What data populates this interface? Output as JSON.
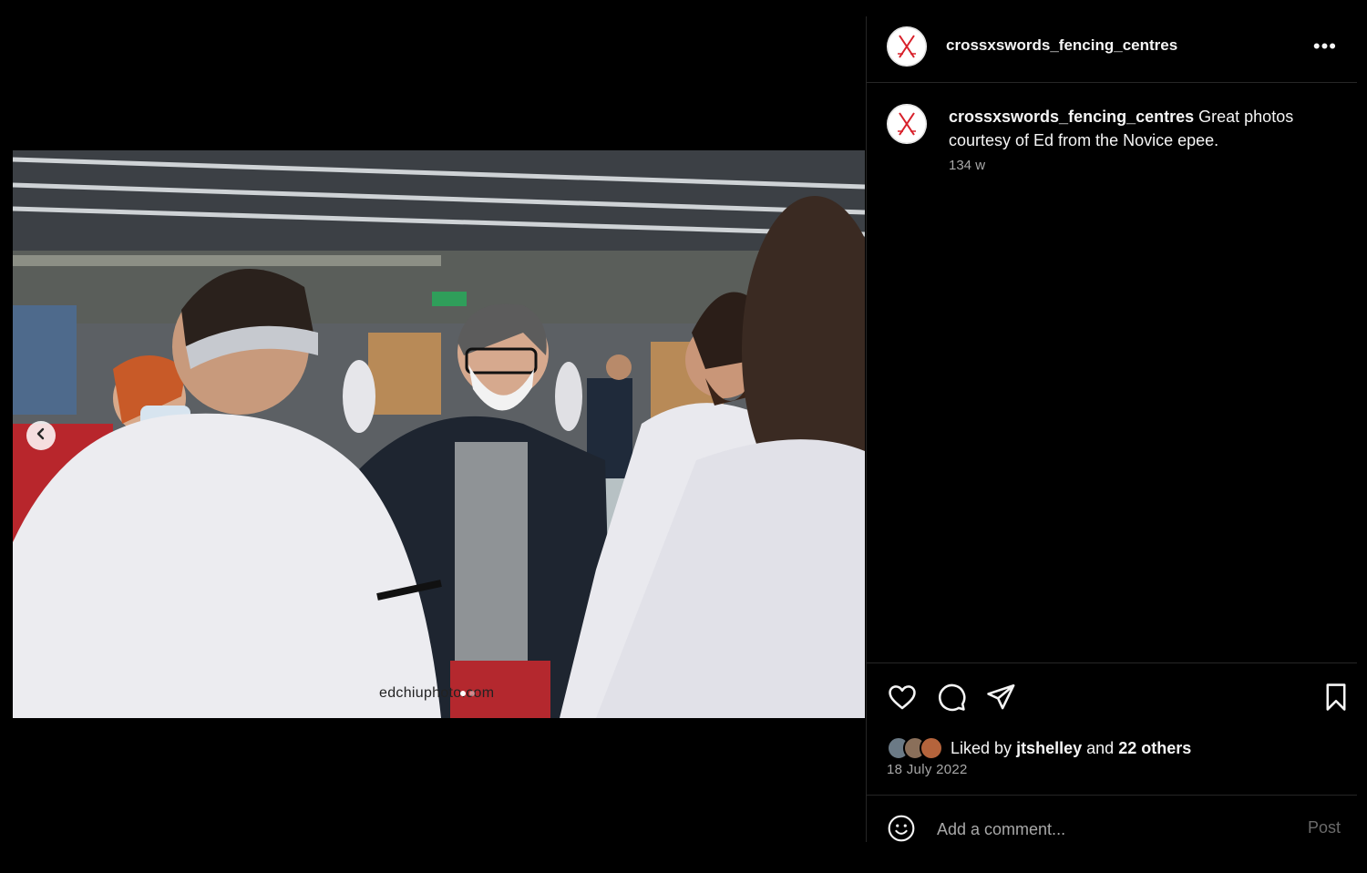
{
  "post": {
    "username": "crossxswords_fencing_centres",
    "more_label": "•••",
    "caption": {
      "username": "crossxswords_fencing_centres",
      "text": "Great photos courtesy of Ed from the Novice epee.",
      "time": "134 w"
    },
    "media": {
      "watermark": "edchiuphoto.com",
      "carousel_dots": 2,
      "active_dot": 0
    },
    "likes": {
      "prefix": "Liked by",
      "user": "jtshelley",
      "and": "and",
      "others": "22 others"
    },
    "date": "18 July 2022",
    "comment": {
      "placeholder": "Add a comment...",
      "post_label": "Post"
    }
  },
  "colors": {
    "background": "#000000",
    "text": "#f5f5f5",
    "muted": "#a8a8a8",
    "divider": "#262626",
    "brand_red": "#d8202a"
  }
}
